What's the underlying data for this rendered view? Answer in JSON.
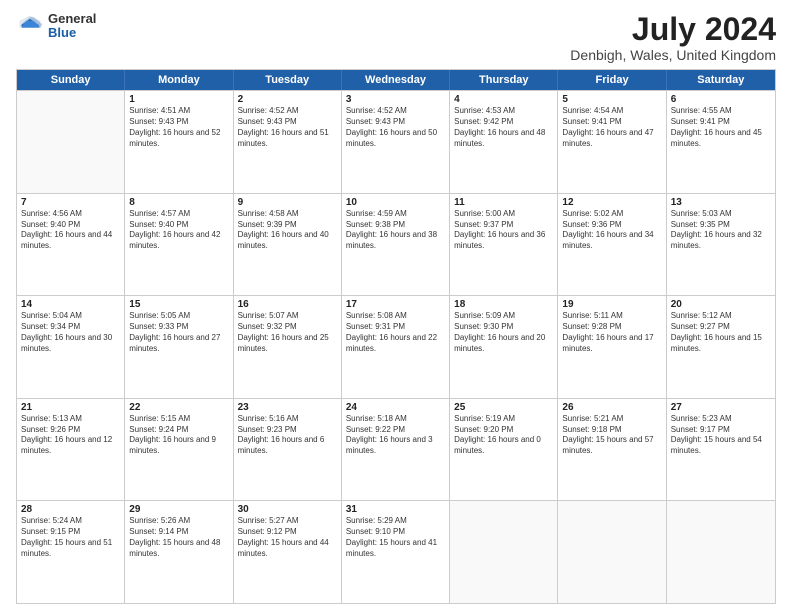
{
  "logo": {
    "general": "General",
    "blue": "Blue"
  },
  "title": "July 2024",
  "subtitle": "Denbigh, Wales, United Kingdom",
  "days_of_week": [
    "Sunday",
    "Monday",
    "Tuesday",
    "Wednesday",
    "Thursday",
    "Friday",
    "Saturday"
  ],
  "weeks": [
    [
      {
        "day": "",
        "empty": true
      },
      {
        "day": "1",
        "sunrise": "4:51 AM",
        "sunset": "9:43 PM",
        "daylight": "16 hours and 52 minutes."
      },
      {
        "day": "2",
        "sunrise": "4:52 AM",
        "sunset": "9:43 PM",
        "daylight": "16 hours and 51 minutes."
      },
      {
        "day": "3",
        "sunrise": "4:52 AM",
        "sunset": "9:43 PM",
        "daylight": "16 hours and 50 minutes."
      },
      {
        "day": "4",
        "sunrise": "4:53 AM",
        "sunset": "9:42 PM",
        "daylight": "16 hours and 48 minutes."
      },
      {
        "day": "5",
        "sunrise": "4:54 AM",
        "sunset": "9:41 PM",
        "daylight": "16 hours and 47 minutes."
      },
      {
        "day": "6",
        "sunrise": "4:55 AM",
        "sunset": "9:41 PM",
        "daylight": "16 hours and 45 minutes."
      }
    ],
    [
      {
        "day": "7",
        "sunrise": "4:56 AM",
        "sunset": "9:40 PM",
        "daylight": "16 hours and 44 minutes."
      },
      {
        "day": "8",
        "sunrise": "4:57 AM",
        "sunset": "9:40 PM",
        "daylight": "16 hours and 42 minutes."
      },
      {
        "day": "9",
        "sunrise": "4:58 AM",
        "sunset": "9:39 PM",
        "daylight": "16 hours and 40 minutes."
      },
      {
        "day": "10",
        "sunrise": "4:59 AM",
        "sunset": "9:38 PM",
        "daylight": "16 hours and 38 minutes."
      },
      {
        "day": "11",
        "sunrise": "5:00 AM",
        "sunset": "9:37 PM",
        "daylight": "16 hours and 36 minutes."
      },
      {
        "day": "12",
        "sunrise": "5:02 AM",
        "sunset": "9:36 PM",
        "daylight": "16 hours and 34 minutes."
      },
      {
        "day": "13",
        "sunrise": "5:03 AM",
        "sunset": "9:35 PM",
        "daylight": "16 hours and 32 minutes."
      }
    ],
    [
      {
        "day": "14",
        "sunrise": "5:04 AM",
        "sunset": "9:34 PM",
        "daylight": "16 hours and 30 minutes."
      },
      {
        "day": "15",
        "sunrise": "5:05 AM",
        "sunset": "9:33 PM",
        "daylight": "16 hours and 27 minutes."
      },
      {
        "day": "16",
        "sunrise": "5:07 AM",
        "sunset": "9:32 PM",
        "daylight": "16 hours and 25 minutes."
      },
      {
        "day": "17",
        "sunrise": "5:08 AM",
        "sunset": "9:31 PM",
        "daylight": "16 hours and 22 minutes."
      },
      {
        "day": "18",
        "sunrise": "5:09 AM",
        "sunset": "9:30 PM",
        "daylight": "16 hours and 20 minutes."
      },
      {
        "day": "19",
        "sunrise": "5:11 AM",
        "sunset": "9:28 PM",
        "daylight": "16 hours and 17 minutes."
      },
      {
        "day": "20",
        "sunrise": "5:12 AM",
        "sunset": "9:27 PM",
        "daylight": "16 hours and 15 minutes."
      }
    ],
    [
      {
        "day": "21",
        "sunrise": "5:13 AM",
        "sunset": "9:26 PM",
        "daylight": "16 hours and 12 minutes."
      },
      {
        "day": "22",
        "sunrise": "5:15 AM",
        "sunset": "9:24 PM",
        "daylight": "16 hours and 9 minutes."
      },
      {
        "day": "23",
        "sunrise": "5:16 AM",
        "sunset": "9:23 PM",
        "daylight": "16 hours and 6 minutes."
      },
      {
        "day": "24",
        "sunrise": "5:18 AM",
        "sunset": "9:22 PM",
        "daylight": "16 hours and 3 minutes."
      },
      {
        "day": "25",
        "sunrise": "5:19 AM",
        "sunset": "9:20 PM",
        "daylight": "16 hours and 0 minutes."
      },
      {
        "day": "26",
        "sunrise": "5:21 AM",
        "sunset": "9:18 PM",
        "daylight": "15 hours and 57 minutes."
      },
      {
        "day": "27",
        "sunrise": "5:23 AM",
        "sunset": "9:17 PM",
        "daylight": "15 hours and 54 minutes."
      }
    ],
    [
      {
        "day": "28",
        "sunrise": "5:24 AM",
        "sunset": "9:15 PM",
        "daylight": "15 hours and 51 minutes."
      },
      {
        "day": "29",
        "sunrise": "5:26 AM",
        "sunset": "9:14 PM",
        "daylight": "15 hours and 48 minutes."
      },
      {
        "day": "30",
        "sunrise": "5:27 AM",
        "sunset": "9:12 PM",
        "daylight": "15 hours and 44 minutes."
      },
      {
        "day": "31",
        "sunrise": "5:29 AM",
        "sunset": "9:10 PM",
        "daylight": "15 hours and 41 minutes."
      },
      {
        "day": "",
        "empty": true
      },
      {
        "day": "",
        "empty": true
      },
      {
        "day": "",
        "empty": true
      }
    ]
  ]
}
